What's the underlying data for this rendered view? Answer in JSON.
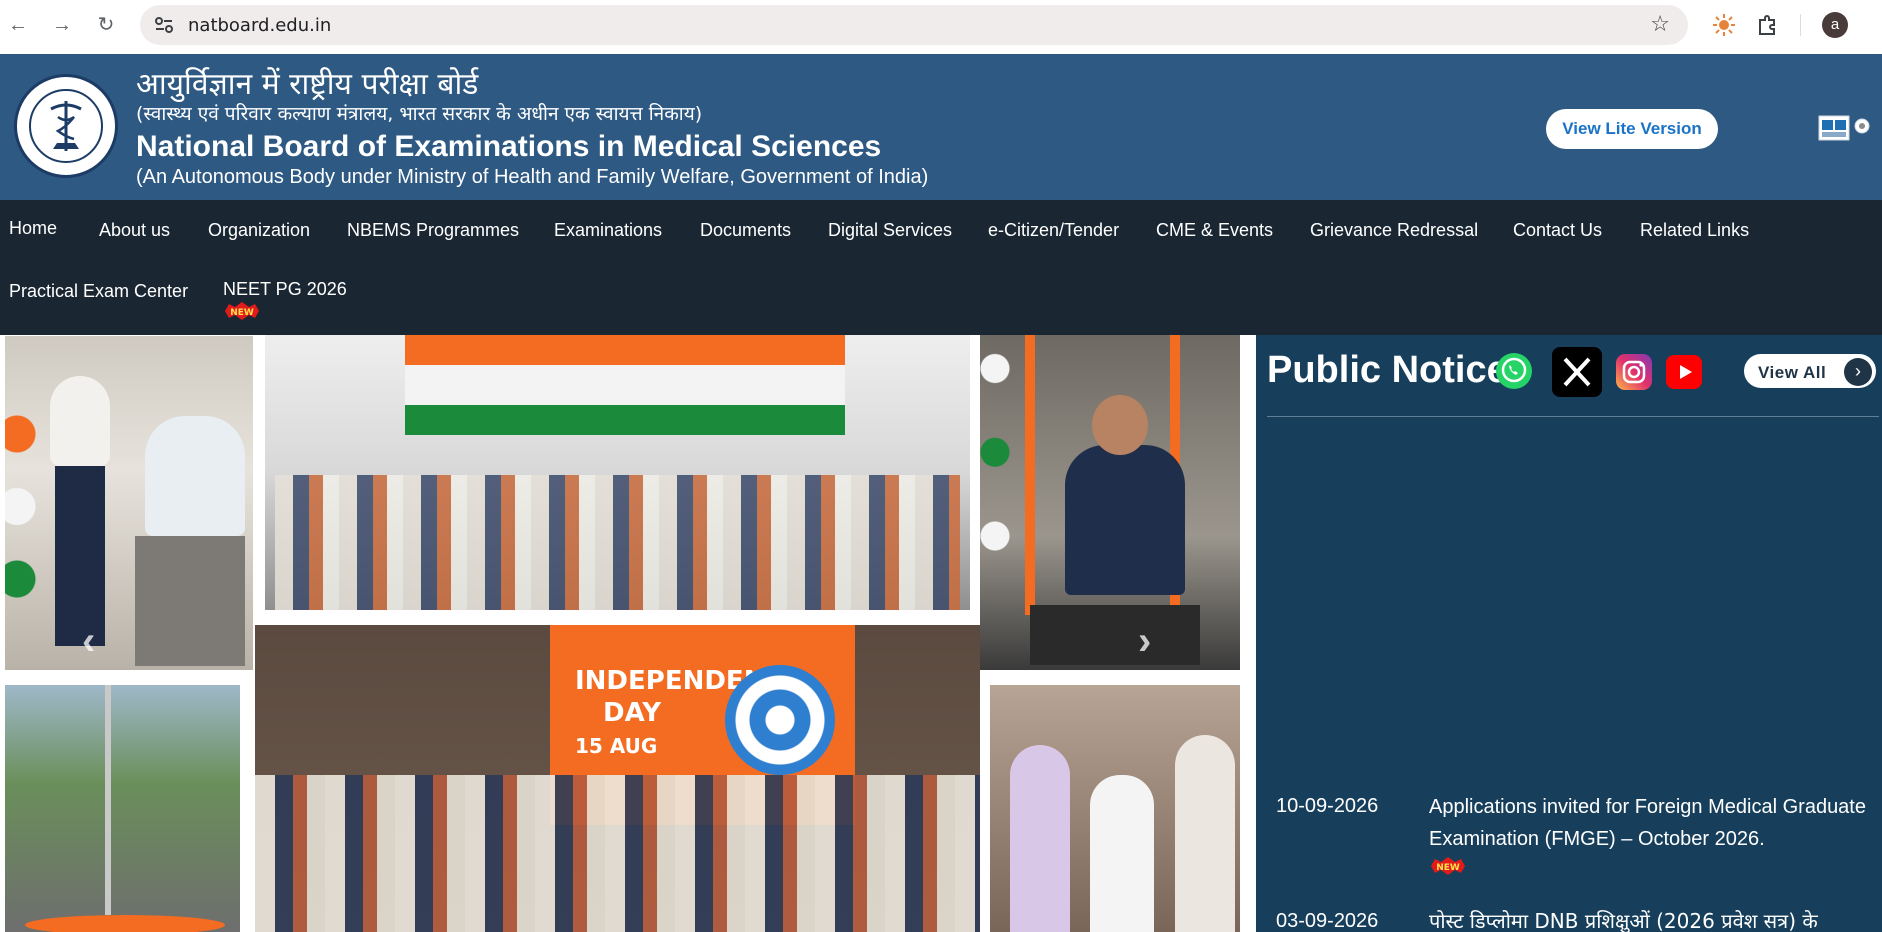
{
  "browser": {
    "url": "natboard.edu.in",
    "avatar_letter": "a"
  },
  "header": {
    "hindi_title": "आयुर्विज्ञान में राष्ट्रीय परीक्षा बोर्ड",
    "hindi_subtitle": "(स्वास्थ्य एवं परिवार कल्याण मंत्रालय, भारत सरकार के अधीन एक स्वायत्त निकाय)",
    "english_title": "National Board of Examinations in Medical Sciences",
    "english_subtitle": "(An Autonomous Body under Ministry of Health and Family Welfare, Government of India)",
    "lite_button": "View Lite Version"
  },
  "nav": {
    "items": [
      "Home",
      "About us",
      "Organization",
      "NBEMS Programmes",
      "Examinations",
      "Documents",
      "Digital Services",
      "e-Citizen/Tender",
      "CME & Events",
      "Grievance Redressal",
      "Contact Us",
      "Related Links",
      "Practical Exam Center",
      "NEET PG 2026"
    ],
    "new_badge": "NEW"
  },
  "carousel": {
    "banner_text_1": "INDEPENDENCE",
    "banner_text_2": "DAY",
    "banner_text_3": "15 AUG"
  },
  "notices": {
    "title": "Public Notice",
    "view_all": "View All",
    "items": [
      {
        "date": "10-09-2026",
        "text": "Applications invited for Foreign Medical Graduate Examination (FMGE) – October 2026.",
        "is_new": true
      },
      {
        "date": "03-09-2026",
        "text": "पोस्ट डिप्लोमा DNB प्रशिक्षुओं (2026 प्रवेश सत्र) के",
        "is_new": false
      }
    ]
  },
  "colors": {
    "header_bg": "#2d5982",
    "nav_bg": "#1a2733",
    "notice_bg": "#173f5c"
  }
}
